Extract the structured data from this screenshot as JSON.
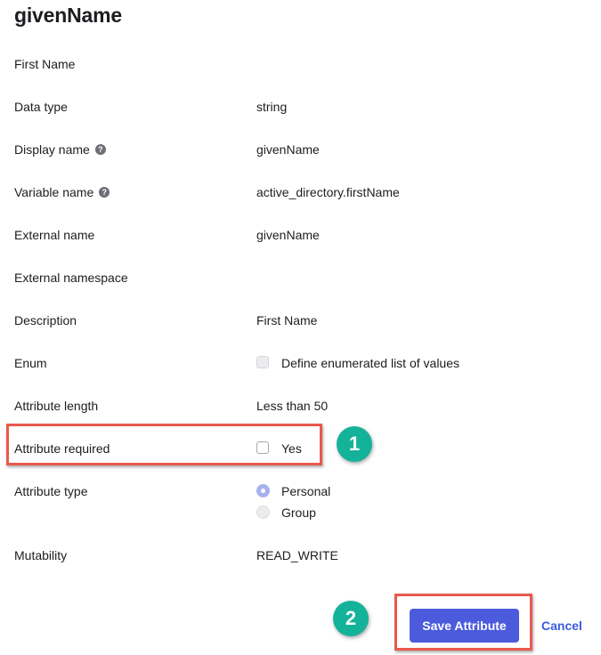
{
  "header": {
    "title": "givenName",
    "subtitle": "First Name"
  },
  "fields": {
    "data_type": {
      "label": "Data type",
      "value": "string"
    },
    "display_name": {
      "label": "Display name",
      "help_icon": "?",
      "value": "givenName"
    },
    "variable_name": {
      "label": "Variable name",
      "help_icon": "?",
      "value": "active_directory.firstName"
    },
    "external_name": {
      "label": "External name",
      "value": "givenName"
    },
    "external_namespace": {
      "label": "External namespace",
      "value": ""
    },
    "description": {
      "label": "Description",
      "value": "First Name"
    },
    "enum": {
      "label": "Enum",
      "checkbox_label": "Define enumerated list of values",
      "checked": false,
      "disabled": true
    },
    "attribute_length": {
      "label": "Attribute length",
      "value": "Less than 50"
    },
    "attribute_required": {
      "label": "Attribute required",
      "checkbox_label": "Yes",
      "checked": false
    },
    "attribute_type": {
      "label": "Attribute type",
      "options": [
        {
          "label": "Personal",
          "selected": true
        },
        {
          "label": "Group",
          "selected": false
        }
      ]
    },
    "mutability": {
      "label": "Mutability",
      "value": "READ_WRITE"
    }
  },
  "actions": {
    "save_label": "Save Attribute",
    "cancel_label": "Cancel"
  },
  "annotations": {
    "step1": "1",
    "step2": "2"
  },
  "colors": {
    "primary_button": "#4b5bdc",
    "link": "#3b5bdb",
    "highlight": "#e9594c",
    "step_badge": "#15b29a",
    "radio_selected": "#a8b1f0"
  }
}
